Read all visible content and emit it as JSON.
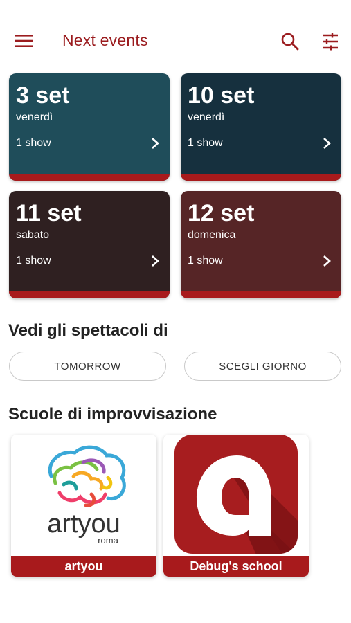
{
  "header": {
    "title": "Next events",
    "icons": [
      "menu-icon",
      "search-icon",
      "filter-icon"
    ]
  },
  "events": [
    {
      "date": "3 set",
      "day": "venerdì",
      "shows": "1 show",
      "color": "#1f4d5a"
    },
    {
      "date": "10 set",
      "day": "venerdì",
      "shows": "1 show",
      "color": "#16303e"
    },
    {
      "date": "11 set",
      "day": "sabato",
      "shows": "1 show",
      "color": "#2f2021"
    },
    {
      "date": "12 set",
      "day": "domenica",
      "shows": "1 show",
      "color": "#562526"
    }
  ],
  "filters": {
    "title": "Vedi gli spettacoli di",
    "tomorrow_label": "TOMORROW",
    "choose_day_label": "SCEGLI GIORNO"
  },
  "schools": {
    "title": "Scuole di improvvisazione",
    "items": [
      {
        "name": "artyou",
        "logo_text": "artyou",
        "logo_subtext": "roma"
      },
      {
        "name": "Debug's school"
      }
    ]
  },
  "colors": {
    "accent": "#9b1c1f",
    "band": "#a81a1c"
  }
}
